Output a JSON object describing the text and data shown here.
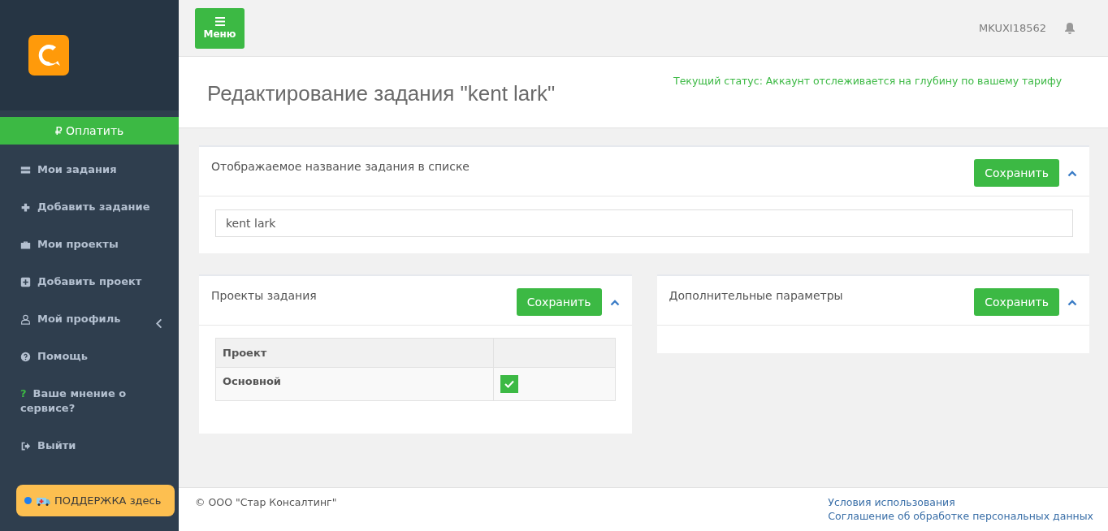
{
  "sidebar": {
    "pay_button": "₽ Оплатить",
    "items": [
      {
        "label": "Мои задания",
        "kind": "list"
      },
      {
        "label": "Добавить задание",
        "kind": "plus"
      },
      {
        "label": "Мои проекты",
        "kind": "briefcase"
      },
      {
        "label": "Добавить проект",
        "kind": "plus-square"
      },
      {
        "label": "Мой профиль",
        "kind": "user",
        "has_submenu": true
      },
      {
        "label": "Помощь",
        "kind": "help-circle"
      },
      {
        "label": "Ваше мнение о сервисе?",
        "kind": "question",
        "icon_text": "?"
      },
      {
        "label": "Выйти",
        "kind": "sign-out"
      }
    ],
    "support_button": "ПОДДЕРЖКА здесь"
  },
  "topbar": {
    "menu_button": "Меню",
    "user": "MKUXI18562"
  },
  "page": {
    "title": "Редактирование задания \"kent lark\"",
    "status": "Текущий статус: Аккаунт отслеживается на глубину по вашему тарифу"
  },
  "panels": [
    {
      "title": "Отображаемое название задания в списке",
      "save": "Сохранить",
      "expanded": true,
      "kind": "input",
      "value": "kent lark"
    },
    {
      "title": "Проекты задания",
      "save": "Сохранить",
      "expanded": true,
      "kind": "table",
      "columns": [
        "Проект"
      ],
      "rows": [
        {
          "name": "Основной",
          "checked": true
        }
      ]
    },
    {
      "title": "Дополнительные параметры",
      "save": "Сохранить",
      "expanded": true,
      "kind": "empty"
    }
  ],
  "footer": {
    "copyright": "© ООО \"Стар Консалтинг\"",
    "links": [
      "Условия использования",
      "Соглашение об обработке персональных данных"
    ]
  }
}
